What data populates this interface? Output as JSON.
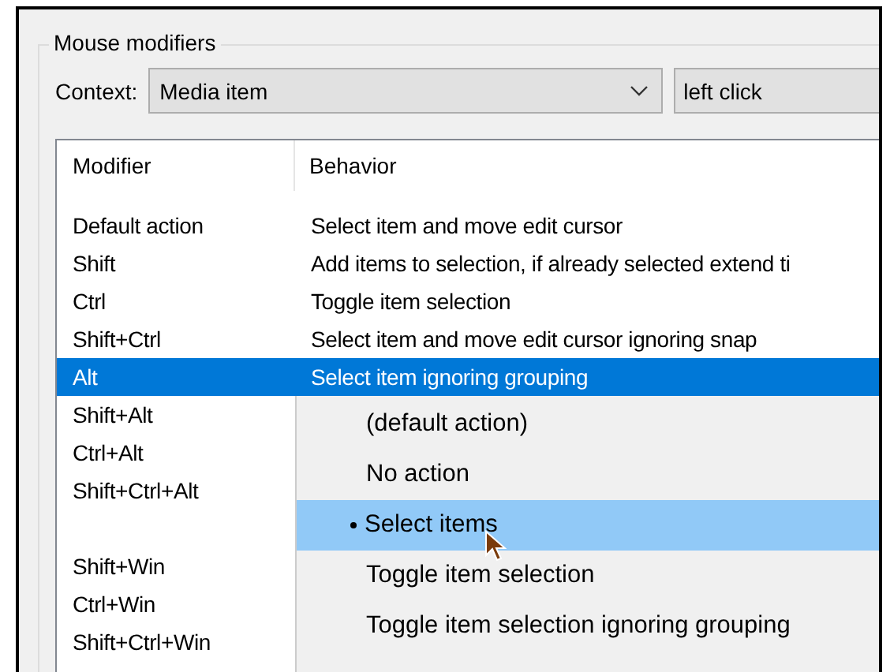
{
  "group": {
    "title": "Mouse modifiers"
  },
  "context": {
    "label": "Context:",
    "value": "Media item",
    "action_value": "left click"
  },
  "list": {
    "columns": [
      "Modifier",
      "Behavior"
    ],
    "rows": [
      {
        "modifier": "Default action",
        "behavior": "Select item and move edit cursor",
        "selected": false
      },
      {
        "modifier": "Shift",
        "behavior": "Add items to selection, if already selected extend ti",
        "selected": false
      },
      {
        "modifier": "Ctrl",
        "behavior": "Toggle item selection",
        "selected": false
      },
      {
        "modifier": "Shift+Ctrl",
        "behavior": "Select item and move edit cursor ignoring snap",
        "selected": false
      },
      {
        "modifier": "Alt",
        "behavior": "Select item ignoring grouping",
        "selected": true
      },
      {
        "modifier": "Shift+Alt",
        "selected": false
      },
      {
        "modifier": "Ctrl+Alt",
        "selected": false
      },
      {
        "modifier": "Shift+Ctrl+Alt",
        "selected": false
      }
    ],
    "win_rows": [
      {
        "modifier": "Shift+Win",
        "selected": false
      },
      {
        "modifier": "Ctrl+Win",
        "selected": false
      },
      {
        "modifier": "Shift+Ctrl+Win",
        "selected": false
      }
    ]
  },
  "menu": {
    "items": [
      {
        "label": "(default action)",
        "checked": false,
        "selected": false
      },
      {
        "label": "No action",
        "checked": false,
        "selected": false
      },
      {
        "label": "Select items",
        "checked": true,
        "selected": true
      },
      {
        "label": "Toggle item selection",
        "checked": false,
        "selected": false
      },
      {
        "label": "Toggle item selection ignoring grouping",
        "checked": false,
        "selected": false
      }
    ]
  }
}
